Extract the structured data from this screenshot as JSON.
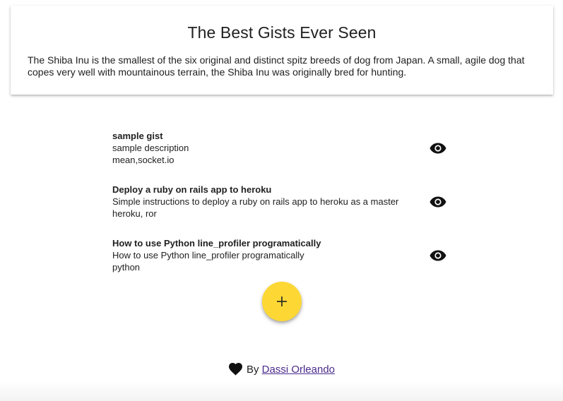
{
  "header": {
    "title": "The Best Gists Ever Seen",
    "description": "The Shiba Inu is the smallest of the six original and distinct spitz breeds of dog from Japan. A small, agile dog that copes very well with mountainous terrain, the Shiba Inu was originally bred for hunting."
  },
  "gists": [
    {
      "title": "sample gist",
      "description": "sample description",
      "tags": "mean,socket.io",
      "icon": "eye-icon"
    },
    {
      "title": "Deploy a ruby on rails app to heroku",
      "description": "Simple instructions to deploy a ruby on rails app to heroku as a master",
      "tags": "heroku, ror",
      "icon": "eye-icon"
    },
    {
      "title": "How to use Python line_profiler programatically",
      "description": "How to use Python line_profiler programatically",
      "tags": "python",
      "icon": "eye-icon"
    }
  ],
  "fab": {
    "icon": "plus-icon",
    "color": "#fdd835"
  },
  "footer": {
    "icon": "heart-icon",
    "by_text": "By",
    "author_link": "Dassi Orleando",
    "link_color": "#4a2a8c"
  }
}
